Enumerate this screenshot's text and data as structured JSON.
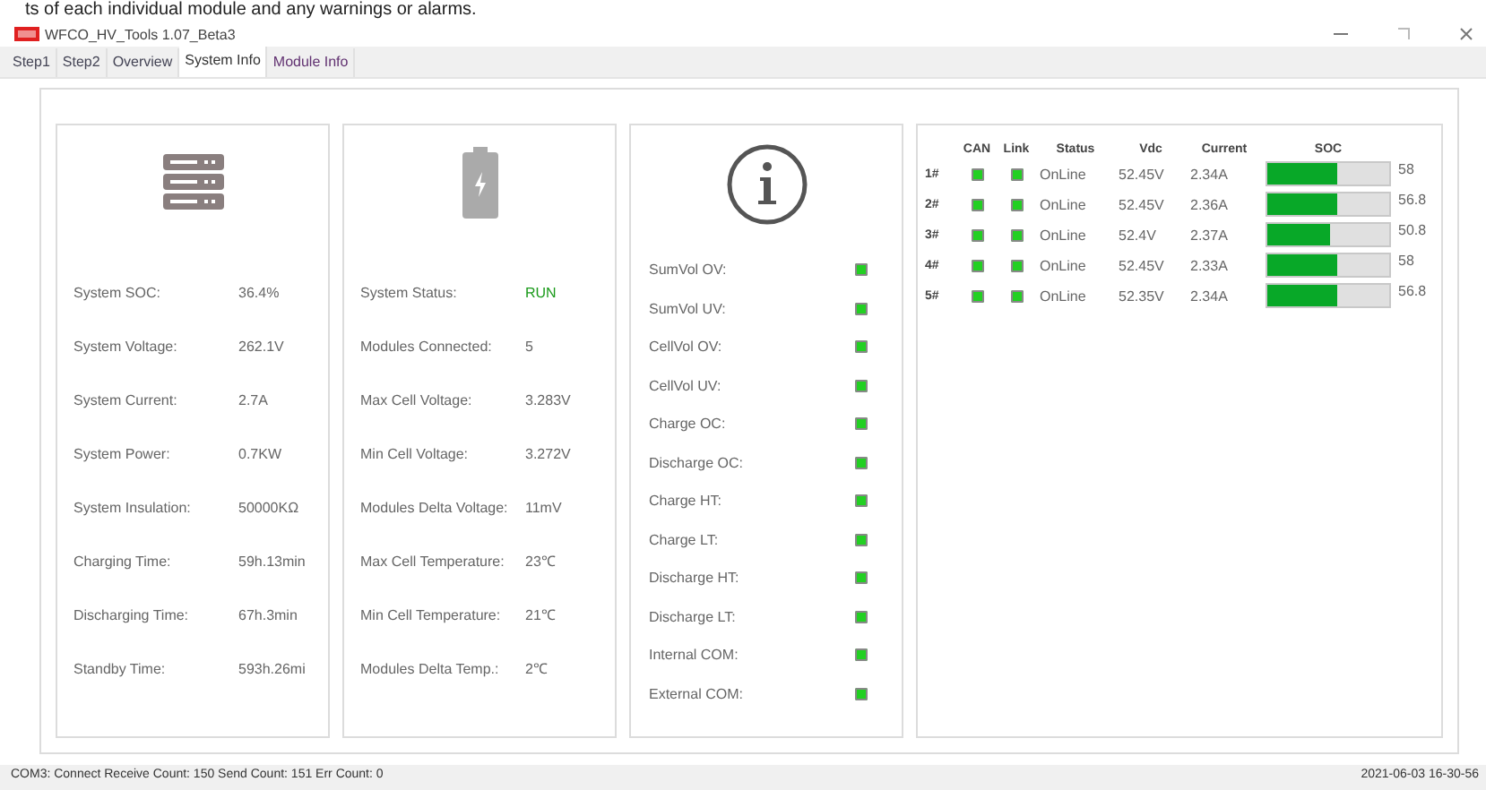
{
  "caption": "ts of each individual module and any warnings or alarms.",
  "window": {
    "title": "WFCO_HV_Tools 1.07_Beta3"
  },
  "tabs": [
    {
      "label": "Step1",
      "selected": false
    },
    {
      "label": "Step2",
      "selected": false
    },
    {
      "label": "Overview",
      "selected": false
    },
    {
      "label": "System Info",
      "selected": true
    },
    {
      "label": "Module Info",
      "selected": false
    }
  ],
  "system": [
    {
      "label": "System SOC:",
      "value": "36.4%"
    },
    {
      "label": "System Voltage:",
      "value": "262.1V"
    },
    {
      "label": "System Current:",
      "value": "2.7A"
    },
    {
      "label": "System Power:",
      "value": "0.7KW"
    },
    {
      "label": "System Insulation:",
      "value": "50000KΩ"
    },
    {
      "label": "Charging Time:",
      "value": "59h.13min"
    },
    {
      "label": "Discharging Time:",
      "value": "67h.3min"
    },
    {
      "label": "Standby Time:",
      "value": "593h.26mi"
    }
  ],
  "battery": [
    {
      "label": "System Status:",
      "value": "RUN",
      "color": "#1a9a1a"
    },
    {
      "label": "Modules Connected:",
      "value": "5",
      "color": "#666666"
    },
    {
      "label": "Max Cell Voltage:",
      "value": "3.283V",
      "color": "#666666"
    },
    {
      "label": "Min Cell Voltage:",
      "value": "3.272V",
      "color": "#666666"
    },
    {
      "label": "Modules Delta Voltage:",
      "value": "11mV",
      "color": "#666666"
    },
    {
      "label": "Max Cell Temperature:",
      "value": "23℃",
      "color": "#666666"
    },
    {
      "label": "Min Cell Temperature:",
      "value": "21℃",
      "color": "#666666"
    },
    {
      "label": "Modules Delta Temp.:",
      "value": "2℃",
      "color": "#666666"
    }
  ],
  "alarms": [
    {
      "label": "SumVol OV:",
      "ok": true
    },
    {
      "label": "SumVol UV:",
      "ok": true
    },
    {
      "label": "CellVol OV:",
      "ok": true
    },
    {
      "label": "CellVol UV:",
      "ok": true
    },
    {
      "label": "Charge OC:",
      "ok": true
    },
    {
      "label": "Discharge OC:",
      "ok": true
    },
    {
      "label": "Charge HT:",
      "ok": true
    },
    {
      "label": "Charge LT:",
      "ok": true
    },
    {
      "label": "Discharge HT:",
      "ok": true
    },
    {
      "label": "Discharge LT:",
      "ok": true
    },
    {
      "label": "Internal COM:",
      "ok": true
    },
    {
      "label": "External COM:",
      "ok": true
    }
  ],
  "modules": {
    "columns": [
      "CAN",
      "Link",
      "Status",
      "Vdc",
      "Current",
      "SOC"
    ],
    "rows": [
      {
        "id": "1#",
        "can": true,
        "link": true,
        "status": "OnLine",
        "vdc": "52.45V",
        "current": "2.34A",
        "level": 0.58,
        "soc": "58"
      },
      {
        "id": "2#",
        "can": true,
        "link": true,
        "status": "OnLine",
        "vdc": "52.45V",
        "current": "2.36A",
        "level": 0.568,
        "soc": "56.8"
      },
      {
        "id": "3#",
        "can": true,
        "link": true,
        "status": "OnLine",
        "vdc": "52.4V",
        "current": "2.37A",
        "level": 0.508,
        "soc": "50.8"
      },
      {
        "id": "4#",
        "can": true,
        "link": true,
        "status": "OnLine",
        "vdc": "52.45V",
        "current": "2.33A",
        "level": 0.58,
        "soc": "58"
      },
      {
        "id": "5#",
        "can": true,
        "link": true,
        "status": "OnLine",
        "vdc": "52.35V",
        "current": "2.34A",
        "level": 0.568,
        "soc": "56.8"
      }
    ]
  },
  "status_bar": {
    "left": "COM3: Connect  Receive Count: 150  Send Count: 151  Err Count: 0",
    "right": "2021-06-03 16-30-56"
  }
}
